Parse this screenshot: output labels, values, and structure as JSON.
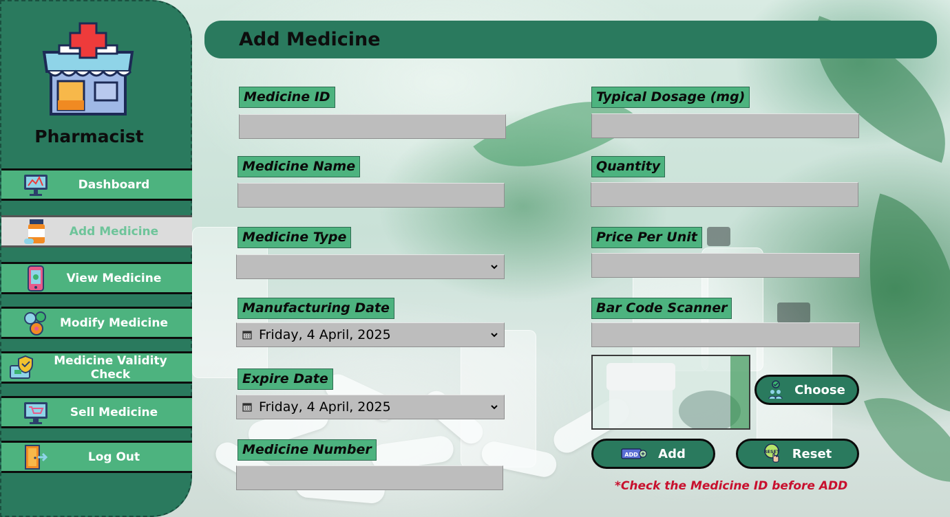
{
  "app": {
    "role_title": "Pharmacist",
    "page_title": "Add Medicine"
  },
  "sidebar": {
    "items": [
      {
        "label": "Dashboard",
        "icon": "dashboard-monitor-icon",
        "active": false
      },
      {
        "label": "Add Medicine",
        "icon": "medicine-bottle-icon",
        "active": true
      },
      {
        "label": "View Medicine",
        "icon": "phone-view-icon",
        "active": false
      },
      {
        "label": "Modify Medicine",
        "icon": "modify-pills-icon",
        "active": false
      },
      {
        "label": "Medicine Validity Check",
        "icon": "validity-shield-icon",
        "active": false
      },
      {
        "label": "Sell Medicine",
        "icon": "shop-cart-icon",
        "active": false
      },
      {
        "label": "Log Out",
        "icon": "logout-door-icon",
        "active": false
      }
    ]
  },
  "form": {
    "medicine_id": {
      "label": "Medicine ID",
      "value": ""
    },
    "medicine_name": {
      "label": "Medicine Name",
      "value": ""
    },
    "medicine_type": {
      "label": "Medicine Type",
      "value": ""
    },
    "manufacturing_date": {
      "label": "Manufacturing Date",
      "value": "Friday, 4 April, 2025"
    },
    "expire_date": {
      "label": "Expire Date",
      "value": "Friday, 4 April, 2025"
    },
    "medicine_number": {
      "label": "Medicine Number",
      "value": ""
    },
    "typical_dosage": {
      "label": "Typical Dosage (mg)",
      "value": ""
    },
    "quantity": {
      "label": "Quantity",
      "value": ""
    },
    "price_per_unit": {
      "label": "Price Per Unit",
      "value": ""
    },
    "bar_code": {
      "label": "Bar Code Scanner",
      "value": ""
    }
  },
  "buttons": {
    "choose": "Choose",
    "add": "Add",
    "add_icon_text": "ADD",
    "reset": "Reset",
    "reset_icon_text": "RESET"
  },
  "warning": "*Check the Medicine ID before ADD",
  "colors": {
    "primary_dark": "#2a7a5e",
    "primary_light": "#4db37f",
    "field_gray": "#bdbdbd",
    "warning_red": "#c8102e"
  }
}
